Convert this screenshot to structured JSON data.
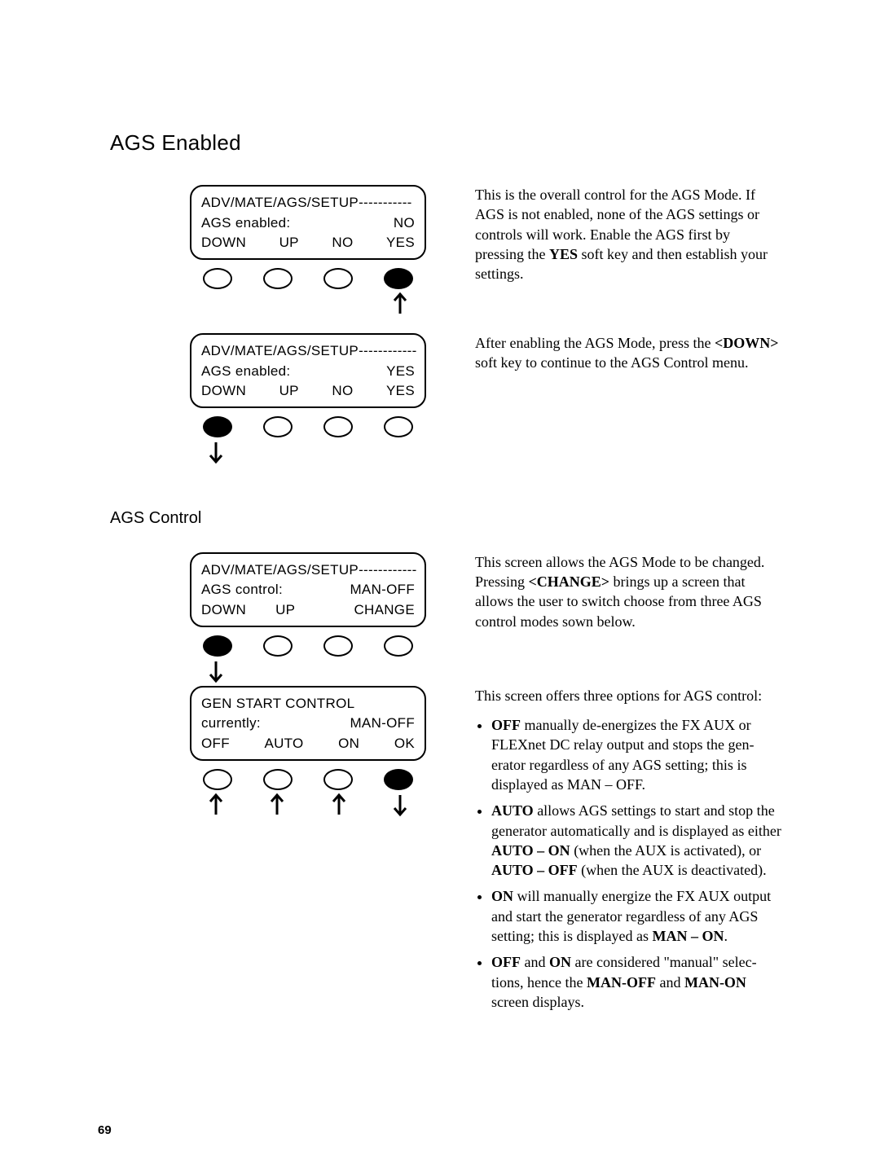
{
  "page_number": "69",
  "h1": "AGS Enabled",
  "h2": "AGS Control",
  "screens": {
    "s1": {
      "header": "ADV/MATE/AGS/SETUP-----------",
      "label": "AGS enabled:",
      "value": "NO",
      "soft": [
        "DOWN",
        "UP",
        "NO",
        "YES"
      ],
      "fill": [
        false,
        false,
        false,
        true
      ],
      "arrows": [
        "",
        "",
        "",
        "up"
      ]
    },
    "s2": {
      "header": "ADV/MATE/AGS/SETUP------------",
      "label": "AGS enabled:",
      "value": "YES",
      "soft": [
        "DOWN",
        "UP",
        "NO",
        "YES"
      ],
      "fill": [
        true,
        false,
        false,
        false
      ],
      "arrows": [
        "down",
        "",
        "",
        ""
      ]
    },
    "s3": {
      "header": "ADV/MATE/AGS/SETUP------------",
      "label": "AGS control:",
      "value": "MAN-OFF",
      "soft": [
        "DOWN",
        "UP",
        "",
        "CHANGE"
      ],
      "fill": [
        true,
        false,
        false,
        false
      ],
      "arrows": [
        "down",
        "",
        "",
        ""
      ]
    },
    "s4": {
      "header": "GEN START CONTROL",
      "label": "currently:",
      "value": "MAN-OFF",
      "soft": [
        "OFF",
        "AUTO",
        "ON",
        "OK"
      ],
      "fill": [
        false,
        false,
        false,
        true
      ],
      "arrows": [
        "up",
        "up",
        "up",
        "down"
      ]
    }
  },
  "desc": {
    "p1a": "This is the overall control for the AGS Mode. If AGS is not enabled, none of the AGS settings or controls will work. Enable the AGS first by pressing the ",
    "p1b": "YES",
    "p1c": " soft key and then establish your settings.",
    "p2a": "After enabling the AGS Mode, press the ",
    "p2b": "<DOWN>",
    "p2c": " soft key to continue to the AGS Con­trol menu.",
    "p3a": "This screen allows the AGS Mode to be changed. Pressing ",
    "p3b": "<CHANGE>",
    "p3c": " brings up a screen that allows the user to switch choose from three AGS control modes sown below.",
    "p4lead": "This screen offers three options for AGS control:",
    "li1a": "OFF",
    "li1b": " manually de-energizes the FX AUX or FLEXnet DC relay output and stops the gen­erator regardless of any AGS setting; this is displayed as MAN – OFF.",
    "li2a": "AUTO",
    "li2b": " allows AGS settings to start and stop the generator automatically and is displayed as ei­ther ",
    "li2c": "AUTO – ON",
    "li2d": " (when the AUX is activated), or ",
    "li2e": "AUTO – OFF",
    "li2f": " (when the AUX is deactivat­ed).",
    "li3a": "ON",
    "li3b": " will manually energize the FX AUX output and start the generator regardless of any AGS setting; this is displayed as ",
    "li3c": "MAN – ON",
    "li3d": ".",
    "li4a": "OFF",
    "li4b": " and ",
    "li4c": "ON",
    "li4d": " are considered \"manual\" selec­tions, hence the ",
    "li4e": "MAN-OFF",
    "li4f": " and ",
    "li4g": "MAN-ON",
    "li4h": " screen displays."
  }
}
